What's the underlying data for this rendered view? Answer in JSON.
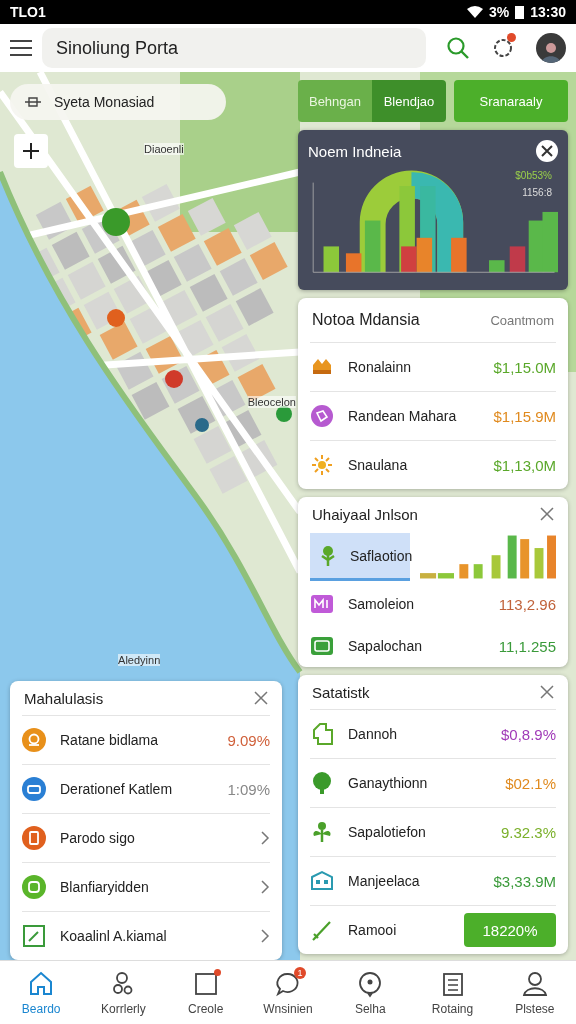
{
  "status_bar": {
    "carrier": "TLO1",
    "battery": "3%",
    "time": "13:30"
  },
  "app_bar": {
    "search_value": "Sinoliung Porta",
    "notification_dot": true
  },
  "map": {
    "search_value": "Syeta Monasiad",
    "labels": [
      {
        "text": "Diaoenli"
      },
      {
        "text": "Bleocelon"
      },
      {
        "text": "Aledyinn"
      }
    ]
  },
  "segments": [
    {
      "label": "Behngan",
      "selected": false
    },
    {
      "label": "Blendjao",
      "selected": true
    }
  ],
  "action_button": "Sranaraaly",
  "chart_card": {
    "title": "Noem Indneia",
    "readouts": [
      "$0b53%",
      "1156:8"
    ]
  },
  "list_card": {
    "title": "Notoa Mdansia",
    "action": "Coantmom",
    "rows": [
      {
        "name": "Ronalainn",
        "value": "$1,15.0M",
        "color": "#5aa82a"
      },
      {
        "name": "Randean Mahara",
        "value": "$1,15.9M",
        "color": "#e08a1e"
      },
      {
        "name": "Snaulana",
        "value": "$1,13,0M",
        "color": "#5aa82a"
      }
    ]
  },
  "compare_card": {
    "title": "Uhaiyaal Jnlson",
    "rows": [
      {
        "name": "Saflaotion",
        "selected": true
      },
      {
        "name": "Samoleion",
        "value": "113,2.96",
        "color": "#c0623a",
        "selected": false
      },
      {
        "name": "Sapalochan",
        "value": "11,1.255",
        "color": "#3a9a3a",
        "selected": false
      }
    ]
  },
  "left_card": {
    "title": "Mahalulasis",
    "rows": [
      {
        "kind": "value",
        "name": "Ratane bidlama",
        "value": "9.09%",
        "color": "#d0603a"
      },
      {
        "kind": "value",
        "name": "Derationef Katlem",
        "value": "1:09%",
        "color": "#888888"
      },
      {
        "kind": "link",
        "name": "Parodo sigo"
      },
      {
        "kind": "link",
        "name": "Blanfiaryidden"
      },
      {
        "kind": "link",
        "name": "Koaalinl A.kiamal"
      }
    ]
  },
  "stats_card": {
    "title": "Satatistk",
    "rows": [
      {
        "kind": "value",
        "name": "Dannoh",
        "value": "$0,8.9%",
        "color": "#a03ab8"
      },
      {
        "kind": "value",
        "name": "Ganaythionn",
        "value": "$02.1%",
        "color": "#e08a1e"
      },
      {
        "kind": "value",
        "name": "Sapalotiefon",
        "value": "9.32.3%",
        "color": "#7ab02a"
      },
      {
        "kind": "value",
        "name": "Manjeelaca",
        "value": "$3,33.9M",
        "color": "#3a9a3a"
      },
      {
        "kind": "button",
        "name": "Ramooi",
        "value": "18220%"
      }
    ]
  },
  "bottom_nav": [
    {
      "label": "Beardo",
      "selected": true,
      "kind": "plain"
    },
    {
      "label": "Korrlerly",
      "selected": false,
      "kind": "plain"
    },
    {
      "label": "Creole",
      "selected": false,
      "kind": "dot"
    },
    {
      "label": "Wnsinien",
      "selected": false,
      "kind": "count",
      "badge": "1"
    },
    {
      "label": "Selha",
      "selected": false,
      "kind": "plain"
    },
    {
      "label": "Rotaing",
      "selected": false,
      "kind": "plain"
    },
    {
      "label": "Plstese",
      "selected": false,
      "kind": "plain"
    }
  ]
}
